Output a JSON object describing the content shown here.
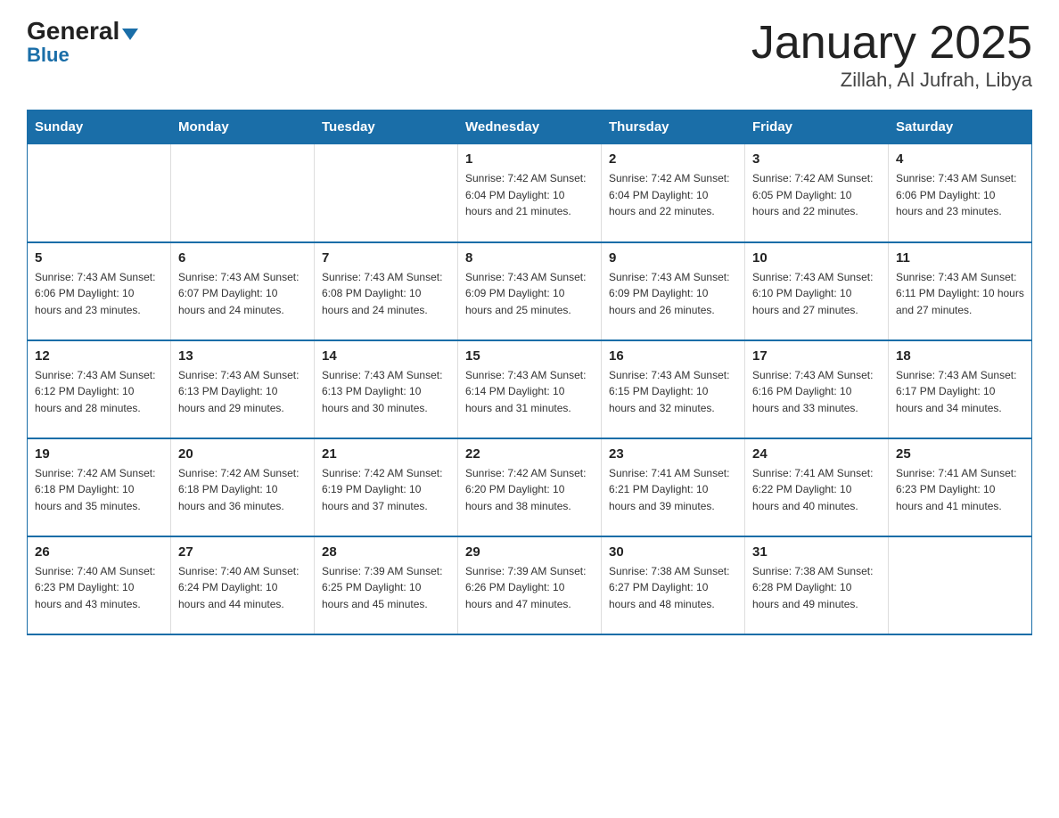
{
  "header": {
    "logo_general": "General",
    "logo_blue": "Blue",
    "title": "January 2025",
    "subtitle": "Zillah, Al Jufrah, Libya"
  },
  "days_of_week": [
    "Sunday",
    "Monday",
    "Tuesday",
    "Wednesday",
    "Thursday",
    "Friday",
    "Saturday"
  ],
  "weeks": [
    [
      {
        "day": "",
        "info": ""
      },
      {
        "day": "",
        "info": ""
      },
      {
        "day": "",
        "info": ""
      },
      {
        "day": "1",
        "info": "Sunrise: 7:42 AM\nSunset: 6:04 PM\nDaylight: 10 hours\nand 21 minutes."
      },
      {
        "day": "2",
        "info": "Sunrise: 7:42 AM\nSunset: 6:04 PM\nDaylight: 10 hours\nand 22 minutes."
      },
      {
        "day": "3",
        "info": "Sunrise: 7:42 AM\nSunset: 6:05 PM\nDaylight: 10 hours\nand 22 minutes."
      },
      {
        "day": "4",
        "info": "Sunrise: 7:43 AM\nSunset: 6:06 PM\nDaylight: 10 hours\nand 23 minutes."
      }
    ],
    [
      {
        "day": "5",
        "info": "Sunrise: 7:43 AM\nSunset: 6:06 PM\nDaylight: 10 hours\nand 23 minutes."
      },
      {
        "day": "6",
        "info": "Sunrise: 7:43 AM\nSunset: 6:07 PM\nDaylight: 10 hours\nand 24 minutes."
      },
      {
        "day": "7",
        "info": "Sunrise: 7:43 AM\nSunset: 6:08 PM\nDaylight: 10 hours\nand 24 minutes."
      },
      {
        "day": "8",
        "info": "Sunrise: 7:43 AM\nSunset: 6:09 PM\nDaylight: 10 hours\nand 25 minutes."
      },
      {
        "day": "9",
        "info": "Sunrise: 7:43 AM\nSunset: 6:09 PM\nDaylight: 10 hours\nand 26 minutes."
      },
      {
        "day": "10",
        "info": "Sunrise: 7:43 AM\nSunset: 6:10 PM\nDaylight: 10 hours\nand 27 minutes."
      },
      {
        "day": "11",
        "info": "Sunrise: 7:43 AM\nSunset: 6:11 PM\nDaylight: 10 hours\nand 27 minutes."
      }
    ],
    [
      {
        "day": "12",
        "info": "Sunrise: 7:43 AM\nSunset: 6:12 PM\nDaylight: 10 hours\nand 28 minutes."
      },
      {
        "day": "13",
        "info": "Sunrise: 7:43 AM\nSunset: 6:13 PM\nDaylight: 10 hours\nand 29 minutes."
      },
      {
        "day": "14",
        "info": "Sunrise: 7:43 AM\nSunset: 6:13 PM\nDaylight: 10 hours\nand 30 minutes."
      },
      {
        "day": "15",
        "info": "Sunrise: 7:43 AM\nSunset: 6:14 PM\nDaylight: 10 hours\nand 31 minutes."
      },
      {
        "day": "16",
        "info": "Sunrise: 7:43 AM\nSunset: 6:15 PM\nDaylight: 10 hours\nand 32 minutes."
      },
      {
        "day": "17",
        "info": "Sunrise: 7:43 AM\nSunset: 6:16 PM\nDaylight: 10 hours\nand 33 minutes."
      },
      {
        "day": "18",
        "info": "Sunrise: 7:43 AM\nSunset: 6:17 PM\nDaylight: 10 hours\nand 34 minutes."
      }
    ],
    [
      {
        "day": "19",
        "info": "Sunrise: 7:42 AM\nSunset: 6:18 PM\nDaylight: 10 hours\nand 35 minutes."
      },
      {
        "day": "20",
        "info": "Sunrise: 7:42 AM\nSunset: 6:18 PM\nDaylight: 10 hours\nand 36 minutes."
      },
      {
        "day": "21",
        "info": "Sunrise: 7:42 AM\nSunset: 6:19 PM\nDaylight: 10 hours\nand 37 minutes."
      },
      {
        "day": "22",
        "info": "Sunrise: 7:42 AM\nSunset: 6:20 PM\nDaylight: 10 hours\nand 38 minutes."
      },
      {
        "day": "23",
        "info": "Sunrise: 7:41 AM\nSunset: 6:21 PM\nDaylight: 10 hours\nand 39 minutes."
      },
      {
        "day": "24",
        "info": "Sunrise: 7:41 AM\nSunset: 6:22 PM\nDaylight: 10 hours\nand 40 minutes."
      },
      {
        "day": "25",
        "info": "Sunrise: 7:41 AM\nSunset: 6:23 PM\nDaylight: 10 hours\nand 41 minutes."
      }
    ],
    [
      {
        "day": "26",
        "info": "Sunrise: 7:40 AM\nSunset: 6:23 PM\nDaylight: 10 hours\nand 43 minutes."
      },
      {
        "day": "27",
        "info": "Sunrise: 7:40 AM\nSunset: 6:24 PM\nDaylight: 10 hours\nand 44 minutes."
      },
      {
        "day": "28",
        "info": "Sunrise: 7:39 AM\nSunset: 6:25 PM\nDaylight: 10 hours\nand 45 minutes."
      },
      {
        "day": "29",
        "info": "Sunrise: 7:39 AM\nSunset: 6:26 PM\nDaylight: 10 hours\nand 47 minutes."
      },
      {
        "day": "30",
        "info": "Sunrise: 7:38 AM\nSunset: 6:27 PM\nDaylight: 10 hours\nand 48 minutes."
      },
      {
        "day": "31",
        "info": "Sunrise: 7:38 AM\nSunset: 6:28 PM\nDaylight: 10 hours\nand 49 minutes."
      },
      {
        "day": "",
        "info": ""
      }
    ]
  ]
}
